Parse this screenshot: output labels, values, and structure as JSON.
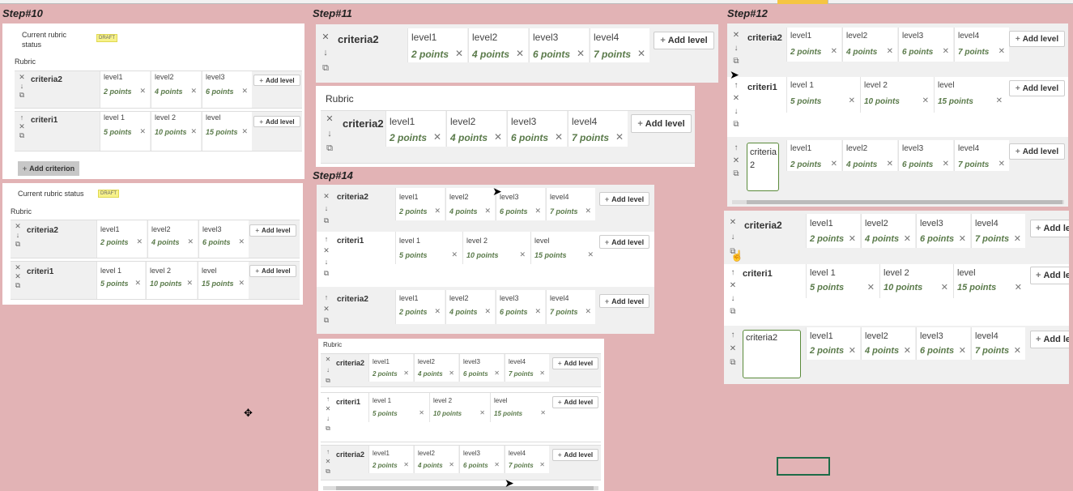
{
  "steps": {
    "s10": "Step#10",
    "s11": "Step#11",
    "s12": "Step#12",
    "s14": "Step#14"
  },
  "rubric_label": "Rubric",
  "status_a": "Current rubric status",
  "draft": "DRAFT",
  "add_level": "Add level",
  "add_criterion": "Add criterion",
  "criteria2": {
    "name": "criteria2",
    "levels": [
      {
        "n": "level1",
        "p": "2 points"
      },
      {
        "n": "level2",
        "p": "4 points"
      },
      {
        "n": "level3",
        "p": "6 points"
      },
      {
        "n": "level4",
        "p": "7 points"
      }
    ]
  },
  "criteria2_short": {
    "name": "criteria2",
    "levels": [
      {
        "n": "level1",
        "p": "2 points"
      },
      {
        "n": "level2",
        "p": "4 points"
      },
      {
        "n": "level3",
        "p": "6 points"
      }
    ]
  },
  "criteri1": {
    "name": "criteri1",
    "levels": [
      {
        "n": "level 1",
        "p": "5 points"
      },
      {
        "n": "level 2",
        "p": "10 points"
      },
      {
        "n": "level",
        "p": "15 points"
      }
    ]
  },
  "criteri1_nospace": {
    "name": "criteri1",
    "levels": [
      {
        "n": "level 1",
        "p": "5 points"
      },
      {
        "n": "level 2",
        "p": "10 points"
      },
      {
        "n": "level",
        "p": "15 points"
      }
    ]
  },
  "textarea1": "criteria 2",
  "textarea2": "criteria2",
  "icons": {
    "delete": "×",
    "down": "↓",
    "up": "↑",
    "copy": "⧉",
    "plus": "+"
  }
}
